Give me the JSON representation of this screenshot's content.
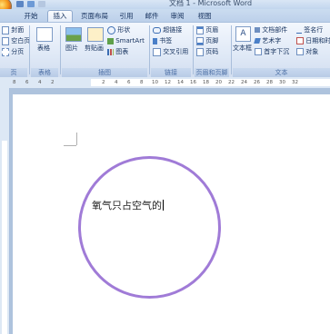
{
  "window": {
    "title": "文档 1 - Microsoft Word"
  },
  "tabs": [
    "开始",
    "插入",
    "页面布局",
    "引用",
    "邮件",
    "审阅",
    "视图"
  ],
  "ribbon": {
    "pages": {
      "items": [
        "封面",
        "空白页",
        "分页"
      ],
      "label": "页"
    },
    "tables": {
      "button": "表格",
      "label": "表格"
    },
    "illustrations": {
      "picture": "图片",
      "clipart": "剪贴画",
      "shapes": "形状",
      "smartart": "SmartArt",
      "chart": "图表",
      "label": "插图"
    },
    "links": {
      "items": [
        "超链接",
        "书签",
        "交叉引用"
      ],
      "label": "链接"
    },
    "header_footer": {
      "items": [
        "页眉",
        "页脚",
        "页码"
      ],
      "label": "页眉和页脚"
    },
    "text": {
      "textbox": "文本框",
      "col1": [
        "文档部件",
        "艺术字",
        "首字下沉"
      ],
      "col2": [
        "签名行",
        "日期和时间",
        "对象"
      ],
      "label": "文本"
    }
  },
  "ruler": {
    "ticks": [
      "8",
      "6",
      "4",
      "2",
      "",
      "2",
      "4",
      "6",
      "8",
      "10",
      "12",
      "14",
      "16",
      "18",
      "20",
      "22",
      "24",
      "26",
      "28",
      "30",
      "32"
    ]
  },
  "document": {
    "text": "氧气只占空气的"
  },
  "colors": {
    "circle": "#a07bd7",
    "ribbon": "#e1eaf7",
    "accent": "#4b6ea4"
  }
}
